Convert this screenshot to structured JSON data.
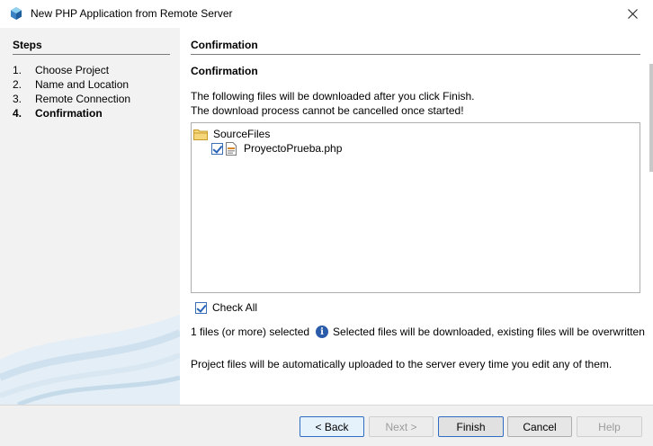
{
  "window": {
    "title": "New PHP Application from Remote Server",
    "app_icon": "netbeans-icon",
    "close_icon": "close-icon"
  },
  "steps": {
    "heading": "Steps",
    "items": [
      {
        "num": "1.",
        "label": "Choose Project"
      },
      {
        "num": "2.",
        "label": "Name and Location"
      },
      {
        "num": "3.",
        "label": "Remote Connection"
      },
      {
        "num": "4.",
        "label": "Confirmation"
      }
    ],
    "current_index": 3
  },
  "panel": {
    "heading": "Confirmation",
    "sub_heading": "Confirmation",
    "desc_line1": "The following files will be downloaded after you click Finish.",
    "desc_line2": "The download process cannot be cancelled once started!",
    "tree": {
      "folder_icon": "folder-icon",
      "folder_label": "SourceFiles",
      "file_icon": "php-file-icon",
      "file_label": "ProyectoPrueba.php",
      "file_checked": true
    },
    "check_all_label": "Check All",
    "check_all_checked": true,
    "status_count": "1 files (or more) selected",
    "status_info_icon": "info-icon",
    "status_message": "Selected files will be downloaded, existing files will be overwritten",
    "upload_note": "Project files will be automatically uploaded to the server every time you edit any of them."
  },
  "buttons": {
    "back": "< Back",
    "next": "Next >",
    "finish": "Finish",
    "cancel": "Cancel",
    "help": "Help"
  },
  "colors": {
    "accent": "#2f6cc4",
    "steps_bg": "#f2f2f2",
    "info_icon": "#2a5caa"
  }
}
